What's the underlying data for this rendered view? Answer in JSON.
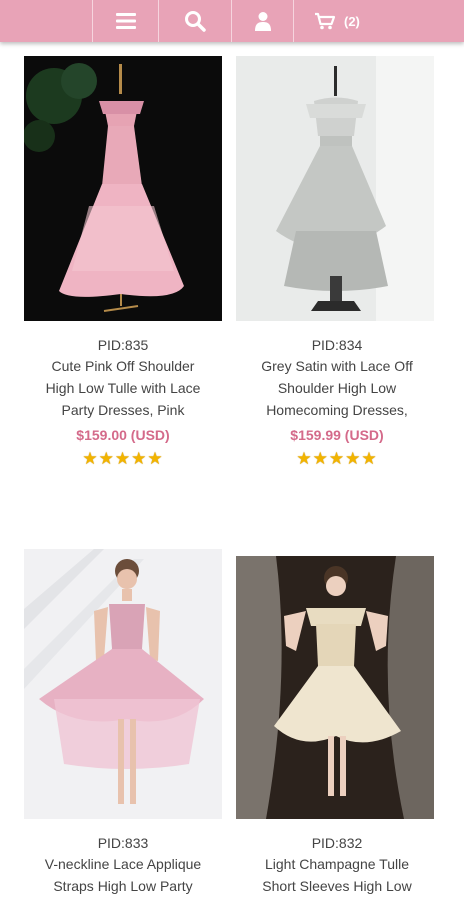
{
  "header": {
    "cart_count": "(2)",
    "icons": [
      "menu-icon",
      "search-icon",
      "account-icon",
      "cart-icon"
    ]
  },
  "colors": {
    "header_bg": "#e8a3b7",
    "price": "#d46a8a",
    "star": "#f2b400"
  },
  "products": [
    {
      "pid": "PID:835",
      "name": [
        "Cute Pink Off Shoulder",
        "High Low Tulle with Lace",
        "Party Dresses, Pink"
      ],
      "price": "$159.00 (USD)",
      "rating": 5
    },
    {
      "pid": "PID:834",
      "name": [
        "Grey Satin with Lace Off",
        "Shoulder High Low",
        "Homecoming Dresses,"
      ],
      "price": "$159.99 (USD)",
      "rating": 5
    },
    {
      "pid": "PID:833",
      "name": [
        "V-neckline Lace Applique",
        "Straps High Low Party"
      ]
    },
    {
      "pid": "PID:832",
      "name": [
        "Light Champagne Tulle",
        "Short Sleeves High Low"
      ]
    }
  ]
}
